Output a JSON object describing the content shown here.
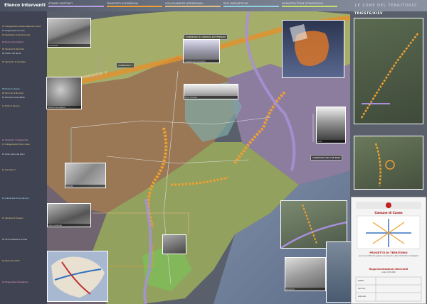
{
  "header": {
    "title": "Elenco Interventi",
    "subtitle": "LE ZONE DEL TERRITORIO",
    "legend_tabs": [
      {
        "label": "STRADE ESISTENTI",
        "color": "#b9a0e0"
      },
      {
        "label": "TRASPORTI DI FERROVIA",
        "color": "#f0a030"
      },
      {
        "label": "COLLEGAMENTI INTERMODALI",
        "color": "#e0c080"
      },
      {
        "label": "RETI ENERGETICHE",
        "color": "#90d0e0"
      },
      {
        "label": "INFRASTRUTTURE STRATEGICHE",
        "color": "#c0e070"
      }
    ]
  },
  "left_panel": {
    "entries": [
      "01 Collegamento autostradale Asti-Cuneo",
      "02 Tangenziale di Cuneo",
      "03 Raddoppio linea ferroviaria",
      "04 Nuovo polo logistico",
      "05 Variante di Demonte",
      "06 Traforo del Tenda",
      "07 Aeroporto di Levaldigi",
      "08 Ponte sul Gesso",
      "09 Svincolo di Mondovì",
      "10 Ferrovia Cuneo-Nizza",
      "11 Porto di Savona",
      "12 Interporto di Alessandria",
      "13 Collegamento Torino-Lione",
      "14 Terzo valico dei Giovi",
      "15 Corridoio V",
      "16 Autostrada Torino-Savona",
      "17 Variante di Fossano",
      "18 Circonvallazione di Alba",
      "19 Raccordo di Bra",
      "20 Tangenziale di Savigliano"
    ]
  },
  "map_labels": {
    "corridoio_v_a": "CORRIDOIO V",
    "corridoio_v_b": "CORRIDOIO V",
    "trieste_kiev": "TRIESTE/KIEV",
    "corridoio_24": "CORRIDOIO 24\nGENOVA-ROTTERDAM",
    "corridoio_1": "CORRIDOIO DEI DUE MARI"
  },
  "photos": [
    {
      "caption": "Autostrada"
    },
    {
      "caption": "Collegamento ferroviario"
    },
    {
      "caption": "Piattaforma logistica"
    },
    {
      "caption": "Nodo stradale"
    },
    {
      "caption": "Viadotto"
    },
    {
      "caption": "Area industriale"
    },
    {
      "caption": "Porto"
    },
    {
      "caption": "Aeroporto"
    }
  ],
  "title_block": {
    "logo": "Comune di Cuneo",
    "project": "PROGETTO DI TERRITORIO",
    "subtitle": "per una più efficiente gestione dei trasporti e delle infrastrutture strategiche",
    "representation": "Rappresentazione Interventi",
    "scale": "scala 1:250.000",
    "rows": [
      "Redatto",
      "Verificato",
      "Approvato"
    ]
  },
  "colors": {
    "sea": "#7b8aa0",
    "land_green": "#9aa860",
    "land_brown": "#8a6850",
    "land_purple": "#8a7a98",
    "route_orange": "#e8902a",
    "route_purple": "#a890d8"
  }
}
